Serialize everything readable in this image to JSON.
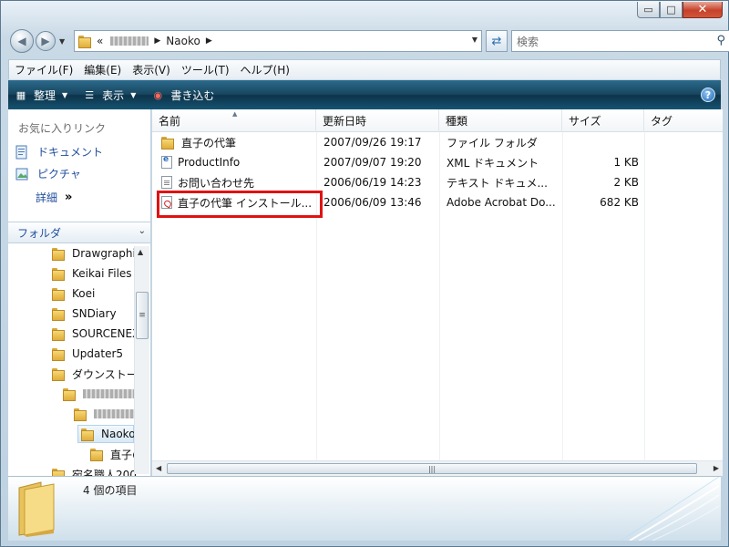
{
  "window": {
    "min_glyph": "▭",
    "max_glyph": "□",
    "close_glyph": "✕"
  },
  "address": {
    "overflow": "«",
    "current": "Naoko",
    "search_placeholder": "検索"
  },
  "menu": [
    "ファイル(F)",
    "編集(E)",
    "表示(V)",
    "ツール(T)",
    "ヘルプ(H)"
  ],
  "toolbar": {
    "organize": "整理",
    "view": "表示",
    "burn": "書き込む",
    "help": "?"
  },
  "nav": {
    "favorites_header": "お気に入りリンク",
    "links": [
      "ドキュメント",
      "ピクチャ"
    ],
    "more": "詳細",
    "more_chevron": "»",
    "folders_header": "フォルダ",
    "tree": [
      "Drawgraphi",
      "Keikai Files",
      "Koei",
      "SNDiary",
      "SOURCENEX",
      "Updater5",
      "ダウンストー",
      "",
      "",
      "Naoko",
      "直子の",
      "宛名職人200"
    ]
  },
  "columns": {
    "name": "名前",
    "date": "更新日時",
    "type": "種類",
    "size": "サイズ",
    "tags": "タグ"
  },
  "files": [
    {
      "name": "直子の代筆",
      "date": "2007/09/26 19:17",
      "type": "ファイル フォルダ",
      "size": "",
      "icon": "folder-icon"
    },
    {
      "name": "ProductInfo",
      "date": "2007/09/07 19:20",
      "type": "XML ドキュメント",
      "size": "1 KB",
      "icon": "xml-file-icon"
    },
    {
      "name": "お問い合わせ先",
      "date": "2006/06/19 14:23",
      "type": "テキスト ドキュメ...",
      "size": "2 KB",
      "icon": "text-file-icon"
    },
    {
      "name": "直子の代筆 インストール...",
      "date": "2006/06/09 13:46",
      "type": "Adobe Acrobat Do...",
      "size": "682 KB",
      "icon": "pdf-file-icon"
    }
  ],
  "status": {
    "item_count": "4 個の項目"
  },
  "colors": {
    "highlight_box": "#e01212",
    "link_blue": "#1f4e9c",
    "toolbar_dark": "#17465f"
  }
}
